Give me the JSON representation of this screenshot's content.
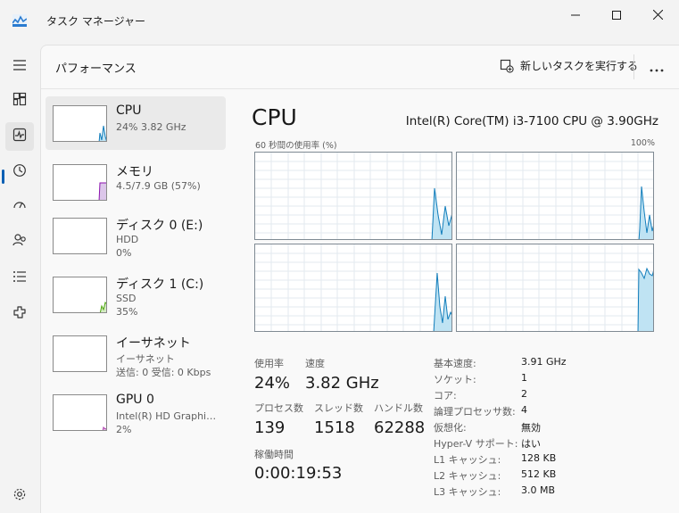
{
  "window": {
    "title": "タスク マネージャー"
  },
  "rail": {
    "items": [
      {
        "icon": "hamburger-menu-icon"
      },
      {
        "icon": "processes-icon"
      },
      {
        "icon": "performance-icon"
      },
      {
        "icon": "app-history-icon"
      },
      {
        "icon": "startup-apps-icon"
      },
      {
        "icon": "users-icon"
      },
      {
        "icon": "details-icon"
      },
      {
        "icon": "services-icon"
      },
      {
        "icon": "settings-icon"
      }
    ],
    "active_index": 2
  },
  "header": {
    "title": "パフォーマンス",
    "new_task_label": "新しいタスクを実行する",
    "more_label": "…"
  },
  "devices": [
    {
      "name": "CPU",
      "sub1": "24%  3.82 GHz",
      "sub2": "",
      "color": "#117dbb"
    },
    {
      "name": "メモリ",
      "sub1": "4.5/7.9 GB (57%)",
      "sub2": "",
      "color": "#8b12ae"
    },
    {
      "name": "ディスク 0 (E:)",
      "sub1": "HDD",
      "sub2": "0%",
      "color": "#4da60c"
    },
    {
      "name": "ディスク 1 (C:)",
      "sub1": "SSD",
      "sub2": "35%",
      "color": "#4da60c"
    },
    {
      "name": "イーサネット",
      "sub1": "イーサネット",
      "sub2": "送信: 0 受信: 0 Kbps",
      "color": "#a74f01"
    },
    {
      "name": "GPU 0",
      "sub1": "Intel(R) HD Graphi…",
      "sub2": "2%",
      "color": "#ac39ac"
    }
  ],
  "detail": {
    "title": "CPU",
    "model": "Intel(R) Core(TM) i3-7100 CPU @ 3.90GHz",
    "graph_caption": "60 秒間の使用率 (%)",
    "graph_max": "100%",
    "graph_color": "#117dbb",
    "graph_fill": "#bfe3f3"
  },
  "stats": {
    "usage_label": "使用率",
    "usage_value": "24%",
    "speed_label": "速度",
    "speed_value": "3.82 GHz",
    "processes_label": "プロセス数",
    "processes_value": "139",
    "threads_label": "スレッド数",
    "threads_value": "1518",
    "handles_label": "ハンドル数",
    "handles_value": "62288",
    "uptime_label": "稼働時間",
    "uptime_value": "0:00:19:53"
  },
  "specs": [
    {
      "key": "基本速度:",
      "value": "3.91 GHz"
    },
    {
      "key": "ソケット:",
      "value": "1"
    },
    {
      "key": "コア:",
      "value": "2"
    },
    {
      "key": "論理プロセッサ数:",
      "value": "4"
    },
    {
      "key": "仮想化:",
      "value": "無効"
    },
    {
      "key": "Hyper-V サポート:",
      "value": "はい"
    },
    {
      "key": "L1 キャッシュ:",
      "value": "128 KB"
    },
    {
      "key": "L2 キャッシュ:",
      "value": "512 KB"
    },
    {
      "key": "L3 キャッシュ:",
      "value": "3.0 MB"
    }
  ]
}
